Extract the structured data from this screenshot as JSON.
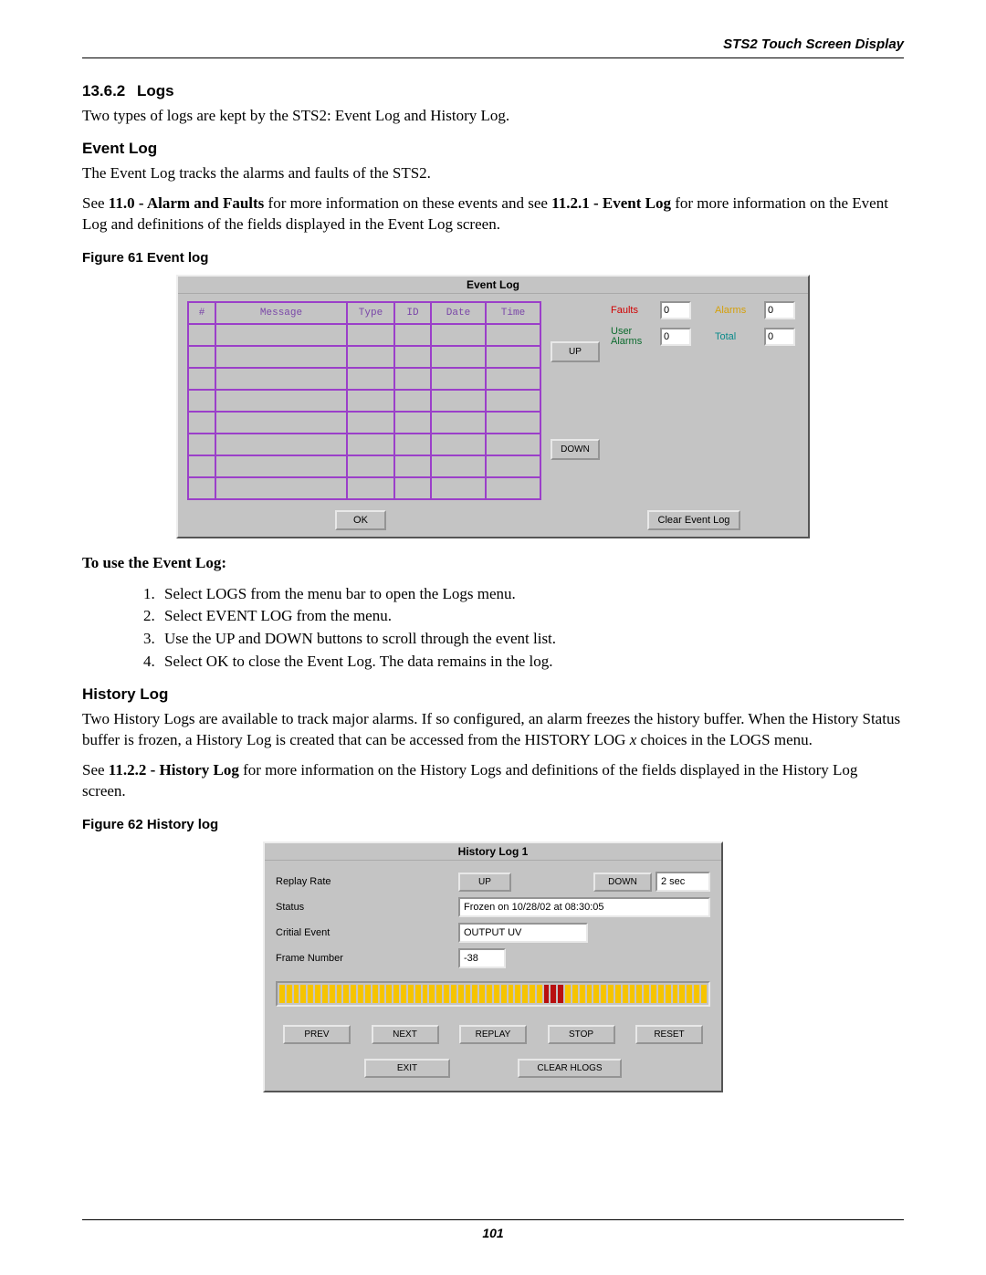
{
  "header": {
    "running": "STS2 Touch Screen Display"
  },
  "section": {
    "number": "13.6.2",
    "title": "Logs"
  },
  "intro": "Two types of logs are kept by the STS2: Event Log and History Log.",
  "eventlog": {
    "heading": "Event Log",
    "p1": "The Event Log tracks the alarms and faults of the STS2.",
    "p2a": "See ",
    "p2b": "11.0 - Alarm and Faults",
    "p2c": " for more information on these events and see ",
    "p2d": "11.2.1 - Event Log",
    "p2e": " for more information on the Event Log and definitions of the fields displayed in the Event Log screen.",
    "fig_caption": "Figure 61   Event log",
    "window_title": "Event Log",
    "cols": {
      "num": "#",
      "msg": "Message",
      "type": "Type",
      "id": "ID",
      "date": "Date",
      "time": "Time"
    },
    "up": "UP",
    "down": "DOWN",
    "counters": {
      "faults_label": "Faults",
      "faults_val": "0",
      "alarms_label": "Alarms",
      "alarms_val": "0",
      "user_label": "User Alarms",
      "user_val": "0",
      "total_label": "Total",
      "total_val": "0"
    },
    "ok": "OK",
    "clear": "Clear Event Log",
    "howto_title": "To use the Event Log:",
    "steps": [
      "Select LOGS from the menu bar to open the Logs menu.",
      "Select EVENT LOG from the menu.",
      "Use the UP and DOWN buttons to scroll through the event list.",
      "Select OK to close the Event Log. The data remains in the log."
    ]
  },
  "historylog": {
    "heading": "History Log",
    "p1a": "Two History Logs are available to track major alarms. If so configured, an alarm freezes the history buffer. When the History Status buffer is frozen, a History Log is created that can be accessed from the HISTORY LOG ",
    "p1_x": "x",
    "p1b": " choices in the LOGS menu.",
    "p2a": "See ",
    "p2b": "11.2.2 - History Log",
    "p2c": " for more information on the History Logs and definitions of the fields displayed in the History Log screen.",
    "fig_caption": "Figure 62   History log",
    "window_title": "History Log 1",
    "labels": {
      "replay": "Replay Rate",
      "status": "Status",
      "critical": "Critial Event",
      "frame": "Frame Number"
    },
    "values": {
      "rate_up": "UP",
      "rate_down": "DOWN",
      "rate_val": "2 sec",
      "status": "Frozen on 10/28/02 at 08:30:05",
      "critical": "OUTPUT UV",
      "frame": "-38"
    },
    "buttons": {
      "prev": "PREV",
      "next": "NEXT",
      "replay": "REPLAY",
      "stop": "STOP",
      "reset": "RESET",
      "exit": "EXIT",
      "clear": "CLEAR HLOGS"
    }
  },
  "footer": {
    "page": "101"
  }
}
